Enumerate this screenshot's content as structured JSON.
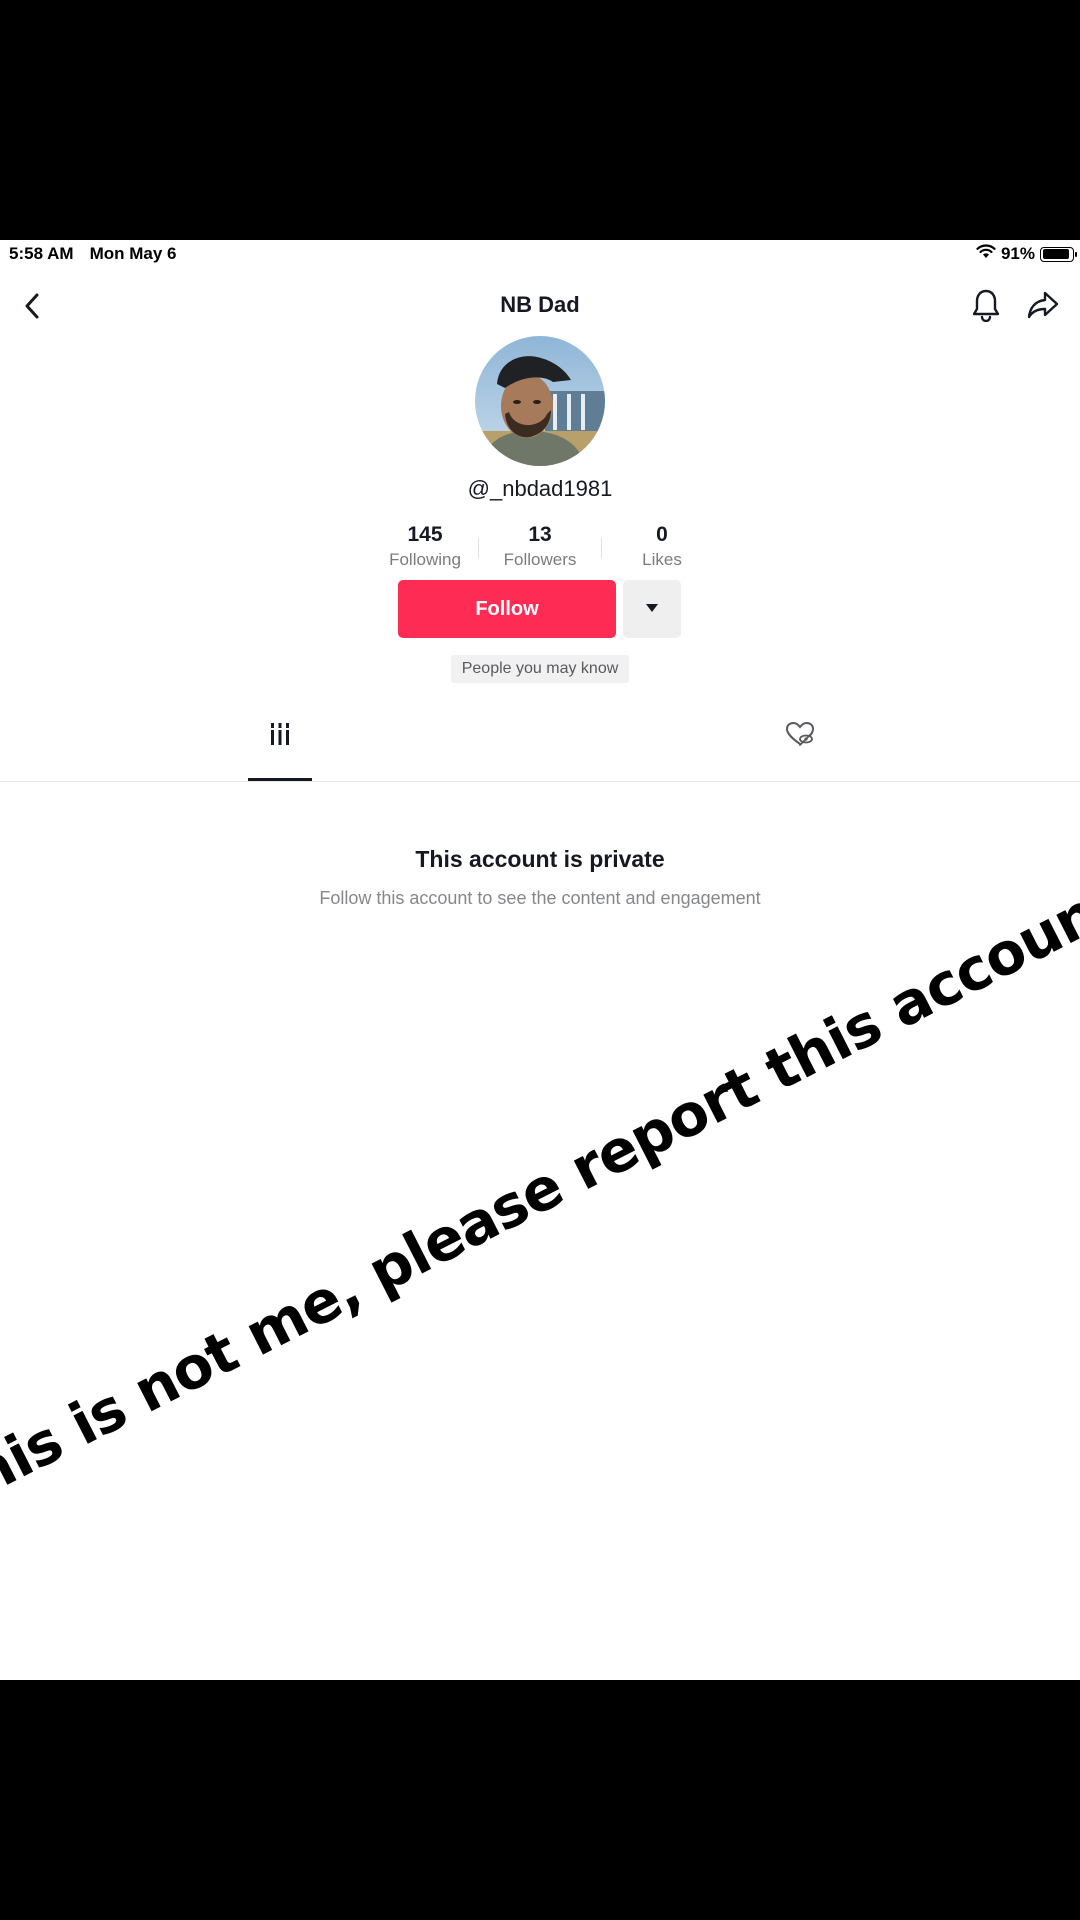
{
  "status_bar": {
    "time": "5:58 AM",
    "date": "Mon May 6",
    "battery": "91%",
    "battery_level": 0.91
  },
  "nav": {
    "title": "NB Dad",
    "back_icon": "chevron-left-icon",
    "bell_icon": "bell-icon",
    "share_icon": "share-arrow-icon"
  },
  "profile": {
    "username": "@_nbdad1981",
    "avatar": "profile-photo"
  },
  "stats": [
    {
      "value": "145",
      "label": "Following"
    },
    {
      "value": "13",
      "label": "Followers"
    },
    {
      "value": "0",
      "label": "Likes"
    }
  ],
  "actions": {
    "follow_label": "Follow",
    "more_icon": "caret-down-icon",
    "pymk_label": "People you may know"
  },
  "tabs": {
    "videos_icon": "grid-bars-icon",
    "liked_icon": "hidden-heart-icon",
    "active": "videos"
  },
  "private": {
    "title": "This account is private",
    "subtitle": "Follow this account to see the content and engagement"
  },
  "overlay": {
    "text": "This is not me, please report this account!"
  },
  "colors": {
    "follow": "#fe2c55",
    "text": "#161823",
    "muted": "#86878b"
  }
}
